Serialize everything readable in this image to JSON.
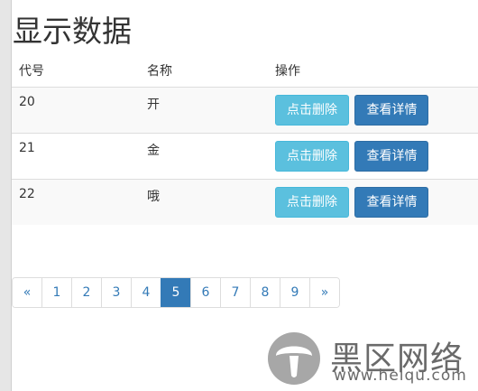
{
  "page": {
    "title": "显示数据"
  },
  "table": {
    "headers": [
      "代号",
      "名称",
      "操作"
    ],
    "rows": [
      {
        "code": "20",
        "name": "开",
        "delete_label": "点击删除",
        "detail_label": "查看详情"
      },
      {
        "code": "21",
        "name": "金",
        "delete_label": "点击删除",
        "detail_label": "查看详情"
      },
      {
        "code": "22",
        "name": "哦",
        "delete_label": "点击删除",
        "detail_label": "查看详情"
      }
    ]
  },
  "pagination": {
    "prev": "«",
    "pages": [
      "1",
      "2",
      "3",
      "4",
      "5",
      "6",
      "7",
      "8",
      "9"
    ],
    "current": "5",
    "next": "»"
  },
  "watermark": {
    "title": "黑区网络",
    "url": "www.heiqu.com",
    "icon": "mushroom-logo-icon"
  },
  "colors": {
    "info": "#5bc0de",
    "primary": "#337ab7",
    "row_stripe": "#f9f9f9"
  }
}
